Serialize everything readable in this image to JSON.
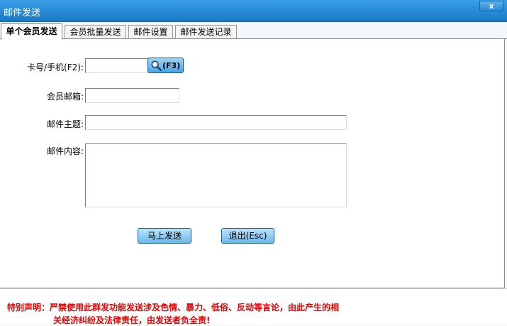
{
  "window": {
    "title": "邮件发送",
    "close_label": "x"
  },
  "tabs": [
    {
      "label": "单个会员发送",
      "active": true
    },
    {
      "label": "会员批量发送",
      "active": false
    },
    {
      "label": "邮件设置",
      "active": false
    },
    {
      "label": "邮件发送记录",
      "active": false
    }
  ],
  "form": {
    "card_label": "卡号/手机(F2):",
    "card_value": "",
    "search_label": "(F3)",
    "email_label": "会员邮箱:",
    "email_value": "",
    "subject_label": "邮件主题:",
    "subject_value": "",
    "content_label": "邮件内容:",
    "content_value": ""
  },
  "buttons": {
    "send_label": "马上发送",
    "exit_label": "退出(Esc)"
  },
  "notice": {
    "line1": "特别声明：严禁使用此群发功能发送涉及色情、暴力、低俗、反动等言论，由此产生的相",
    "line2": "关经济纠纷及法律责任，由发送者负全责!",
    "color": "#e60000"
  },
  "colors": {
    "titlebar": "#1a78c6",
    "button": "#6bb8ec"
  },
  "icons": {
    "search": "magnifier-icon",
    "close": "close-icon"
  }
}
